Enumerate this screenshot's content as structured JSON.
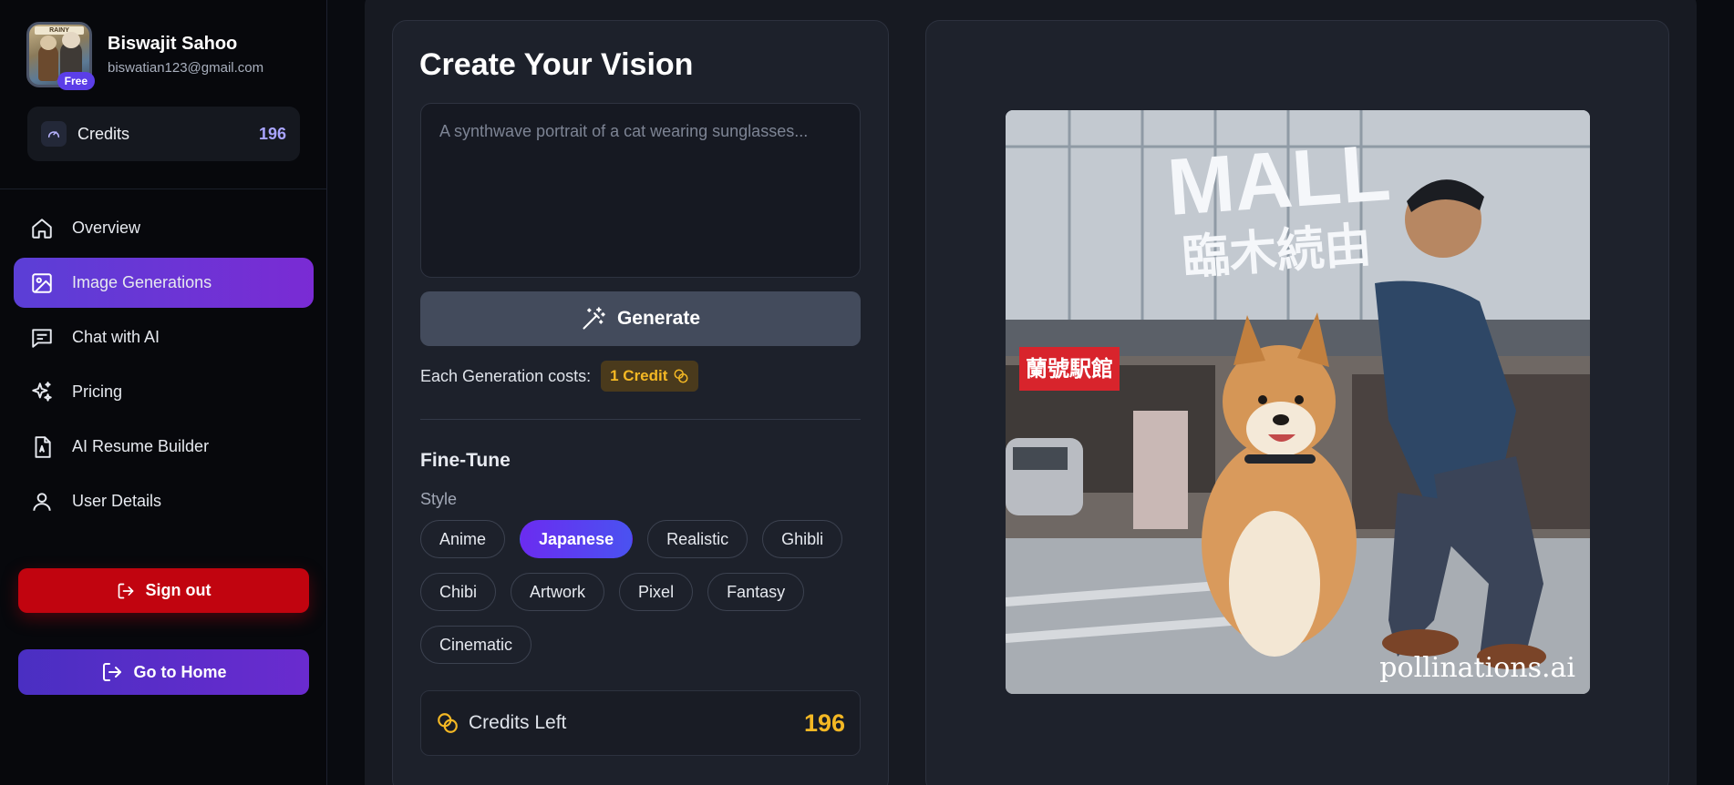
{
  "user": {
    "name": "Biswajit Sahoo",
    "email": "biswatian123@gmail.com",
    "plan_badge": "Free",
    "avatar_sign": "RAINY"
  },
  "sidebar": {
    "credits_label": "Credits",
    "credits_value": "196",
    "items": [
      {
        "label": "Overview",
        "icon": "home-icon",
        "active": false
      },
      {
        "label": "Image Generations",
        "icon": "image-icon",
        "active": true
      },
      {
        "label": "Chat with AI",
        "icon": "chat-icon",
        "active": false
      },
      {
        "label": "Pricing",
        "icon": "sparkles-icon",
        "active": false
      },
      {
        "label": "AI Resume Builder",
        "icon": "resume-icon",
        "active": false
      },
      {
        "label": "User Details",
        "icon": "user-icon",
        "active": false
      }
    ],
    "signout_label": "Sign out",
    "home_label": "Go to Home"
  },
  "create": {
    "title": "Create Your Vision",
    "prompt_placeholder": "A synthwave portrait of a cat wearing sunglasses...",
    "prompt_value": "",
    "generate_label": "Generate",
    "cost_label": "Each Generation costs:",
    "cost_badge": "1 Credit",
    "finetune_title": "Fine-Tune",
    "style_label": "Style",
    "styles_row1": [
      "Anime",
      "Japanese",
      "Realistic",
      "Ghibli"
    ],
    "styles_row2": [
      "Chibi",
      "Artwork",
      "Pixel",
      "Fantasy"
    ],
    "styles_row3": [
      "Cinematic"
    ],
    "selected_style": "Japanese",
    "credits_left_label": "Credits Left",
    "credits_left_value": "196"
  },
  "image": {
    "sign_text": "MALL",
    "sign_cjk": "臨木続由",
    "red_sign": "蘭號駅館",
    "watermark": "pollinations.ai"
  },
  "colors": {
    "accent_purple": "#5b3fd6",
    "signout_red": "#c1040f",
    "credit_gold": "#f4b824",
    "credit_violet": "#a9a4ff"
  }
}
